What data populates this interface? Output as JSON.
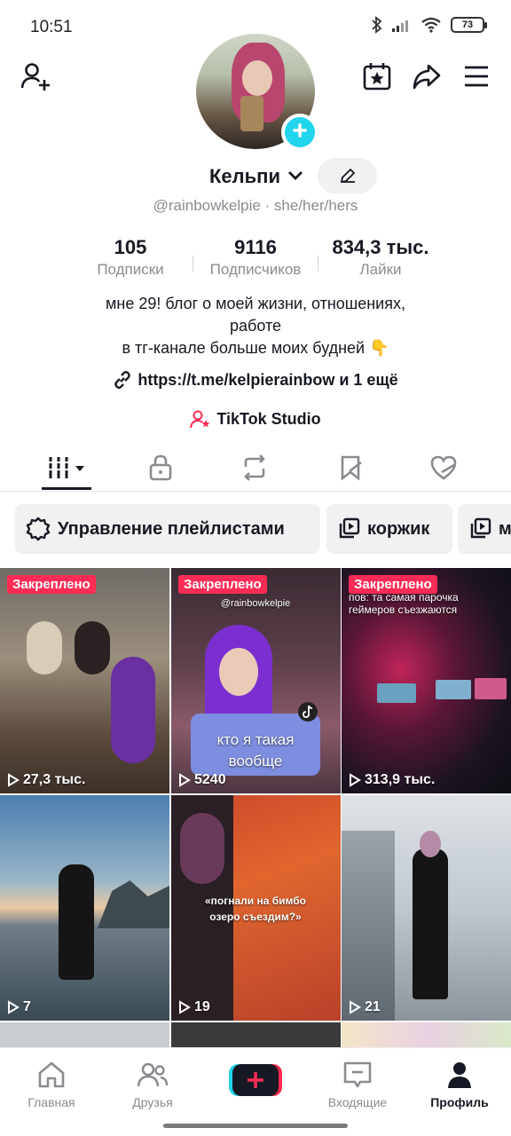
{
  "status_bar": {
    "time": "10:51",
    "battery": "73"
  },
  "profile": {
    "name": "Кельпи",
    "handle": "@rainbowkelpie · she/her/hers",
    "stats": [
      {
        "value": "105",
        "label": "Подписки"
      },
      {
        "value": "9116",
        "label": "Подписчиков"
      },
      {
        "value": "834,3 тыс.",
        "label": "Лайки"
      }
    ],
    "bio_line1": "мне 29! блог о моей жизни, отношениях,",
    "bio_line2": "работе",
    "bio_line3": "в тг-канале больше моих будней 👇",
    "link": "https://t.me/kelpierainbow и 1 ещё",
    "studio": "TikTok Studio"
  },
  "tabs": [
    {
      "icon": "grid-icon",
      "active": true
    },
    {
      "icon": "lock-icon"
    },
    {
      "icon": "repost-icon"
    },
    {
      "icon": "bookmark-icon"
    },
    {
      "icon": "liked-heart-icon"
    }
  ],
  "chips": [
    {
      "label": "Управление плейлистами",
      "icon": "gear-icon"
    },
    {
      "label": "коржик",
      "icon": "playlist-icon"
    },
    {
      "label": "м",
      "icon": "playlist-icon"
    }
  ],
  "videos": [
    {
      "pinned": "Закреплено",
      "views": "27,3 тыс."
    },
    {
      "pinned": "Закреплено",
      "views": "5240",
      "caption": "кто я такая вообще",
      "watermark": "@rainbowkelpie"
    },
    {
      "pinned": "Закреплено",
      "views": "313,9 тыс.",
      "caption": "пов: та самая парочка геймеров съезжаются"
    },
    {
      "views": "7"
    },
    {
      "views": "19",
      "caption": "«погнали на бимбо озеро съездим?»"
    },
    {
      "views": "21"
    }
  ],
  "nav": {
    "home": "Главная",
    "friends": "Друзья",
    "inbox": "Входящие",
    "profile": "Профиль"
  },
  "colors": {
    "accent": "#fe2c55",
    "cyan": "#20d5ec",
    "text": "#161823",
    "muted": "#8a8b91"
  }
}
